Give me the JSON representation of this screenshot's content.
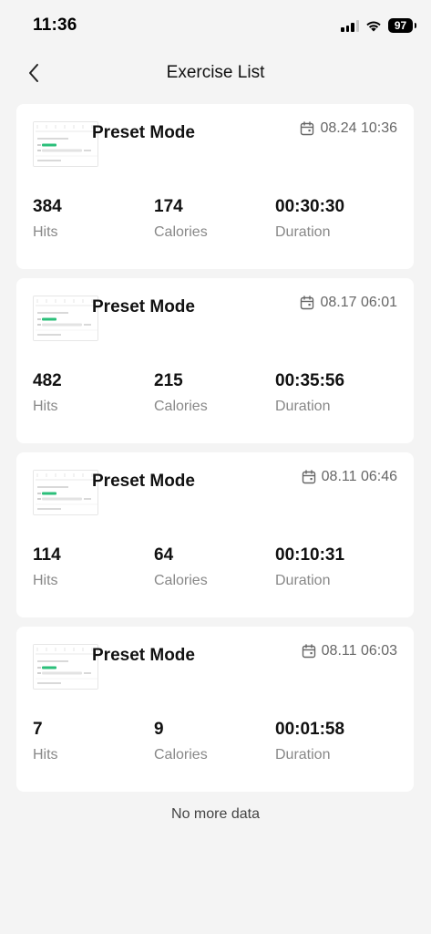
{
  "status_bar": {
    "time": "11:36",
    "battery": "97"
  },
  "header": {
    "title": "Exercise List"
  },
  "labels": {
    "hits": "Hits",
    "calories": "Calories",
    "duration": "Duration"
  },
  "records": [
    {
      "mode": "Preset Mode",
      "date": "08.24 10:36",
      "hits": "384",
      "calories": "174",
      "duration": "00:30:30"
    },
    {
      "mode": "Preset Mode",
      "date": "08.17 06:01",
      "hits": "482",
      "calories": "215",
      "duration": "00:35:56"
    },
    {
      "mode": "Preset Mode",
      "date": "08.11 06:46",
      "hits": "114",
      "calories": "64",
      "duration": "00:10:31"
    },
    {
      "mode": "Preset Mode",
      "date": "08.11 06:03",
      "hits": "7",
      "calories": "9",
      "duration": "00:01:58"
    }
  ],
  "footer": {
    "no_more": "No more data"
  },
  "colors": {
    "accent": "#2bbf7a",
    "background": "#f4f4f4"
  }
}
